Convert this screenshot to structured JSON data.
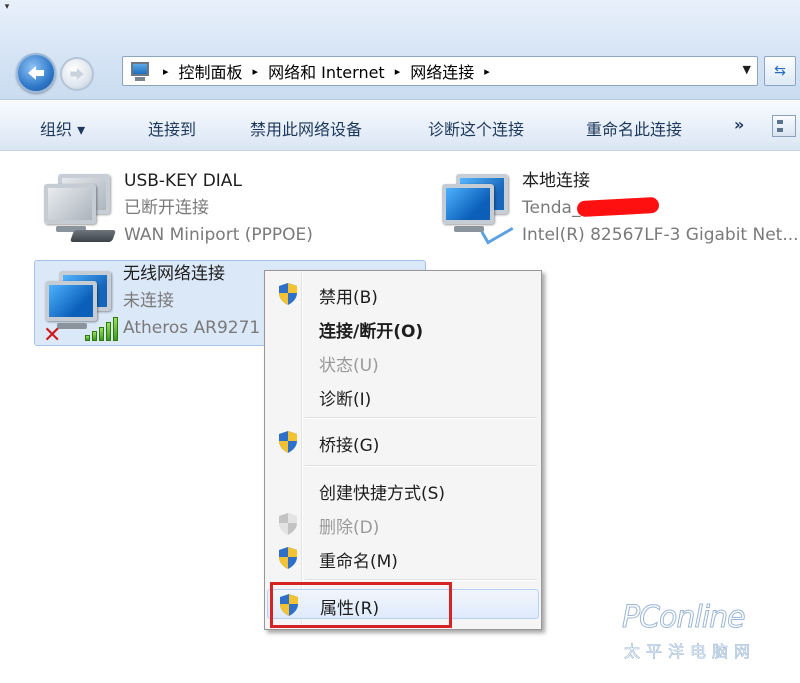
{
  "navigation": {
    "back_label": "←",
    "recent_label": "▾"
  },
  "address_bar": {
    "crumbs": [
      "控制面板",
      "网络和 Internet",
      "网络连接"
    ],
    "separator": "▸",
    "dropdown": "▼",
    "refresh": "⇆"
  },
  "toolbar": {
    "organize": "组织 ▾",
    "connect_to": "连接到",
    "disable_device": "禁用此网络设备",
    "diagnose": "诊断这个连接",
    "rename": "重命名此连接",
    "more": "»"
  },
  "connections": [
    {
      "name": "USB-KEY DIAL",
      "status": "已断开连接",
      "device": "WAN Miniport (PPPOE)"
    },
    {
      "name": "本地连接",
      "status": "Tenda_",
      "device": "Intel(R) 82567LF-3 Gigabit Net..."
    },
    {
      "name": "无线网络连接",
      "status": "未连接",
      "device": "Atheros AR9271"
    }
  ],
  "context_menu": {
    "items": [
      {
        "label": "禁用(B)"
      },
      {
        "label": "连接/断开(O)"
      },
      {
        "label": "状态(U)"
      },
      {
        "label": "诊断(I)"
      },
      {
        "label": "桥接(G)"
      },
      {
        "label": "创建快捷方式(S)"
      },
      {
        "label": "删除(D)"
      },
      {
        "label": "重命名(M)"
      },
      {
        "label": "属性(R)"
      }
    ]
  },
  "watermark": {
    "logo": "PConline",
    "sub": "太平洋电脑网"
  },
  "colors": {
    "highlight_box": "#d62424",
    "toolbar_text": "#1e395b",
    "menu_background": "#f5f5f5",
    "selection_background": "#dbe8f8"
  }
}
